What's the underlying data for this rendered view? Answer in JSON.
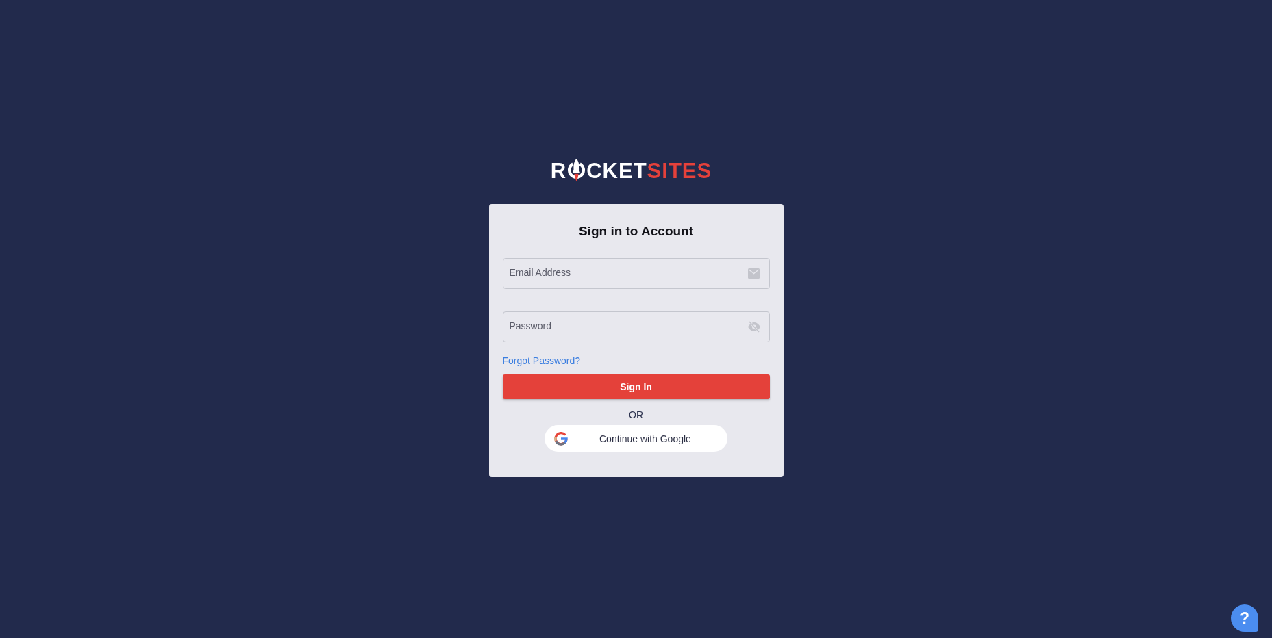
{
  "logo": {
    "lead": "R",
    "middle": "CKET",
    "accent": "SITES"
  },
  "card": {
    "title": "Sign in to Account",
    "fields": [
      {
        "kind": "email",
        "placeholder": "Email Address"
      },
      {
        "kind": "password",
        "placeholder": "Password",
        "visible": false
      }
    ],
    "forgot_link": "Forgot Password?",
    "submit_button": "Sign In",
    "divider_text": "OR",
    "google_button": "Continue with Google"
  },
  "help_button": {
    "label": "?"
  }
}
